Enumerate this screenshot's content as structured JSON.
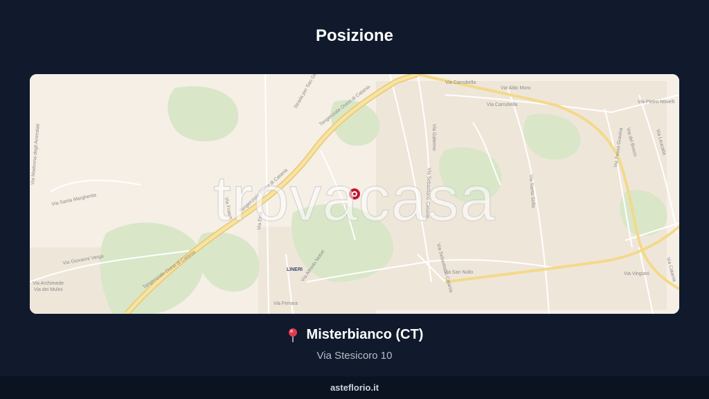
{
  "header": {
    "title": "Posizione"
  },
  "map": {
    "watermark": "trovacasa",
    "labels": {
      "tangenziale_1": "Tangenziale Ovest di Catania",
      "tangenziale_2": "Tangenziale Ovest di Catania",
      "tangenziale_3": "Tangenziale Ovest di Catania",
      "tangenziale_4": "Tangenziale Ovest di Catania",
      "via_carrubella_1": "Via Carrubella",
      "via_carrubella_2": "Via Carrubella",
      "via_aldo_moro": "Via Aldo Moro",
      "via_pietro_novelli": "Via Pietro Novelli",
      "via_galermo": "Via Galermo",
      "via_sebastiano_catania_1": "Via Sebastiano Catania",
      "via_sebastiano_catania_2": "Via Sebastiano Catania",
      "via_san_nullo": "Via San Nullo",
      "via_santa_sofia": "Via Santa Sofia",
      "via_del_bosco": "Via del Bosco",
      "via_passo_gravina": "Via Passo Gravina",
      "via_santa_margherita": "Via Santa Margherita",
      "via_giovanni_verga": "Via Giovanni Verga",
      "via_archimede": "Via Archimede",
      "via_dei_mulini": "Via dei Mulini",
      "via_alfredo_nobel": "Via Alfredo Nobel",
      "via_etna": "Via Etna",
      "via_ferrara": "Via Ferrara",
      "via_fratelli": "Via Fratelli",
      "via_madonna": "Via Madonna degli Ammalati",
      "strada_san": "Strada per San Giovanni",
      "lineri": "LINERI",
      "via_catania": "Via Catania",
      "via_vingiani": "Via Vingiani",
      "via_leucatia": "Via Leucatia"
    }
  },
  "location": {
    "pin_icon": "map-pin-icon",
    "name": "Misterbianco (CT)",
    "address": "Via Stesicoro 10"
  },
  "footer": {
    "site": "asteflorio.it"
  },
  "colors": {
    "background": "#111a2c",
    "map_base": "#f5efe6",
    "green_area": "#d9e6c8",
    "highway": "#f3d98a",
    "pin": "#c8102e"
  }
}
